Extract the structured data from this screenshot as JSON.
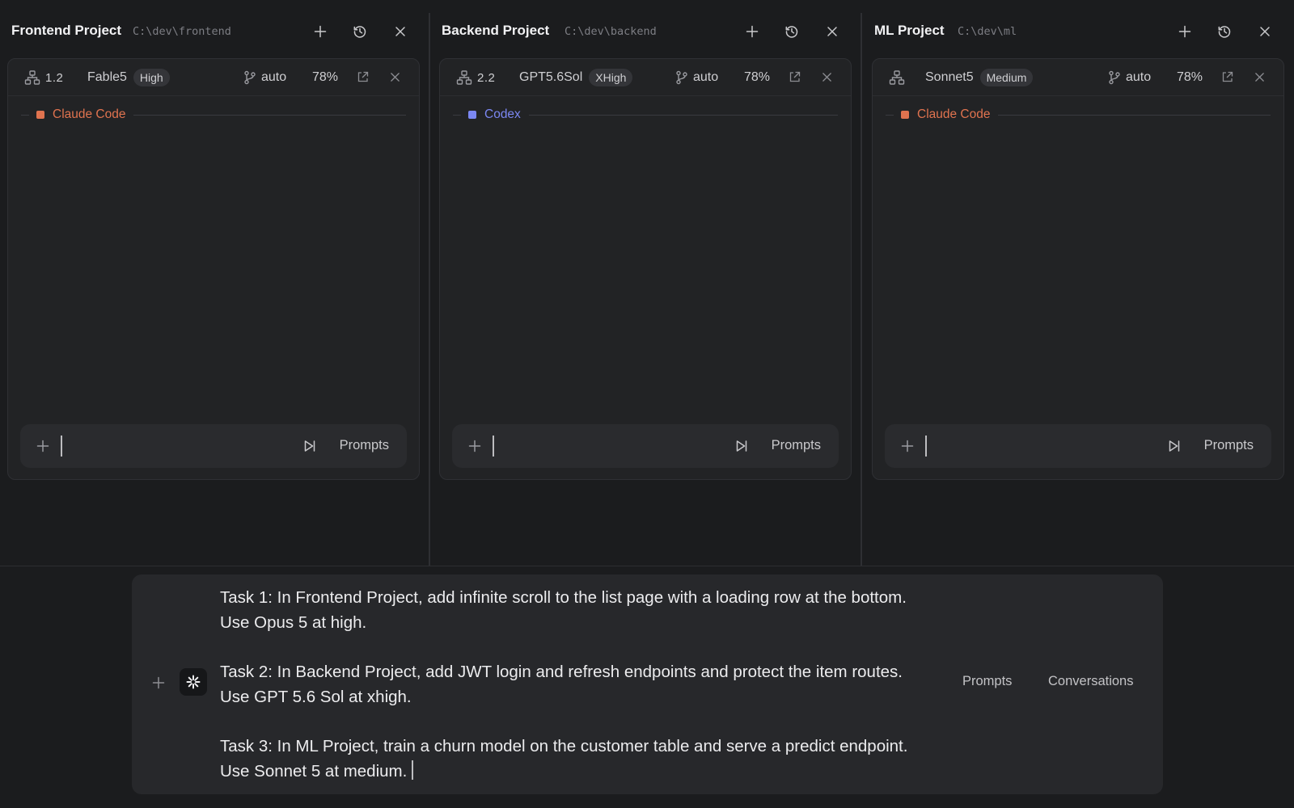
{
  "colors": {
    "claude_code": "#e0734f",
    "codex": "#7b87f2"
  },
  "projects": [
    {
      "title": "Frontend Project",
      "path": "C:\\dev\\frontend",
      "index": "1.2",
      "model": "Fable5",
      "effort": "High",
      "branch": "auto",
      "context": "78%",
      "agent": "Claude Code",
      "agent_color": "#e0734f",
      "input_value": "",
      "prompts_label": "Prompts"
    },
    {
      "title": "Backend Project",
      "path": "C:\\dev\\backend",
      "index": "2.2",
      "model": "GPT5.6Sol",
      "effort": "XHigh",
      "branch": "auto",
      "context": "78%",
      "agent": "Codex",
      "agent_color": "#7b87f2",
      "input_value": "",
      "prompts_label": "Prompts"
    },
    {
      "title": "ML Project",
      "path": "C:\\dev\\ml",
      "index": "",
      "model": "Sonnet5",
      "effort": "Medium",
      "branch": "auto",
      "context": "78%",
      "agent": "Claude Code",
      "agent_color": "#e0734f",
      "input_value": "",
      "prompts_label": "Prompts"
    }
  ],
  "header_icons": [
    "plus-icon",
    "history-icon",
    "close-icon"
  ],
  "card_icons": [
    "hierarchy-icon",
    "git-branch-icon",
    "external-link-icon",
    "close-icon",
    "plus-icon",
    "skip-forward-icon"
  ],
  "composer": {
    "lines": [
      "Task 1: In Frontend Project, add infinite scroll to the list page with a loading row at the bottom.",
      "Use Opus 5 at high.",
      "",
      "Task 2: In Backend Project, add JWT login and refresh endpoints and protect the item routes.",
      "Use GPT 5.6 Sol at xhigh.",
      "",
      "Task 3: In ML Project, train a churn model on the customer table and serve a predict endpoint.",
      "Use Sonnet 5 at medium."
    ],
    "prompts_label": "Prompts",
    "conversations_label": "Conversations",
    "icons": [
      "plus-icon",
      "sparkle-icon"
    ]
  }
}
